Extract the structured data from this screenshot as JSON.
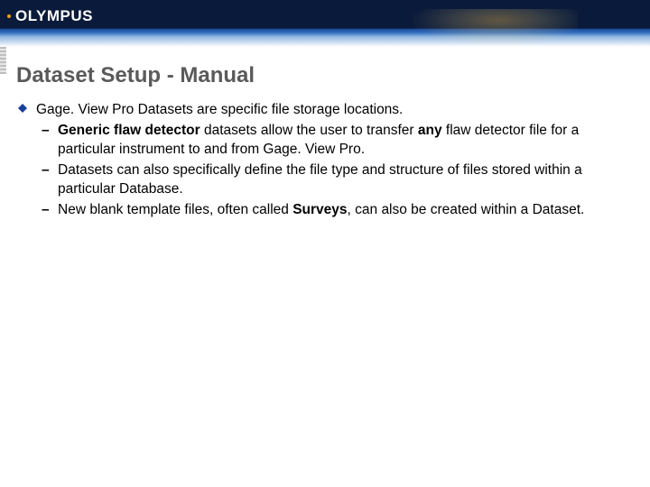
{
  "brand": {
    "logo_text": "OLYMPUS"
  },
  "slide": {
    "title": "Dataset Setup - Manual",
    "bullet1": "Gage. View Pro Datasets are specific file storage locations.",
    "sub1_prefix_bold": "Generic flaw detector",
    "sub1_middle": " datasets allow the user to transfer ",
    "sub1_any_bold": "any",
    "sub1_rest": " flaw detector file for a particular instrument to and from Gage. View Pro.",
    "sub2": "Datasets can also specifically define the file type and structure of files stored within a particular Database.",
    "sub3_before": "New blank template files, often called ",
    "sub3_bold": "Surveys",
    "sub3_after": ", can also be created within a Dataset."
  }
}
